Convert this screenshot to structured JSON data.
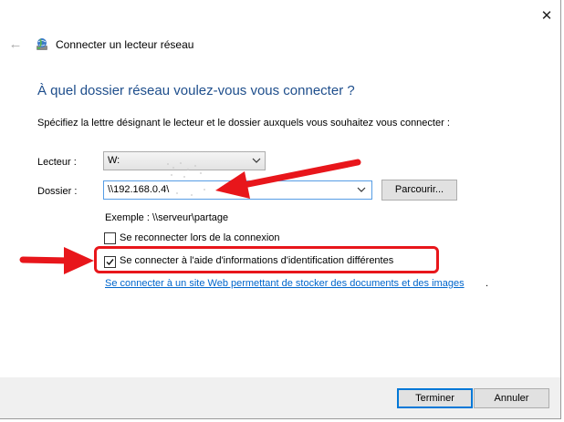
{
  "window": {
    "title": "Connecter un lecteur réseau",
    "close_symbol": "✕",
    "back_symbol": "←"
  },
  "main": {
    "heading": "À quel dossier réseau voulez-vous vous connecter ?",
    "instruction": "Spécifiez la lettre désignant le lecteur et le dossier auxquels vous souhaitez vous connecter :",
    "drive_label": "Lecteur :",
    "drive_value": "W:",
    "folder_label": "Dossier :",
    "folder_value": "\\\\192.168.0.4\\",
    "browse_label": "Parcourir...",
    "example": "Exemple : \\\\serveur\\partage",
    "reconnect_label": "Se reconnecter lors de la connexion",
    "reconnect_checked": false,
    "credentials_label": "Se connecter à l'aide d'informations d'identification différentes",
    "credentials_checked": true,
    "link_text": "Se connecter à un site Web permettant de stocker des documents et des images",
    "link_suffix": "."
  },
  "footer": {
    "finish_label": "Terminer",
    "cancel_label": "Annuler"
  },
  "colors": {
    "heading": "#1e4e8c",
    "link": "#0066cc",
    "annotation_red": "#e8161b",
    "primary_border": "#0078d7"
  },
  "icons": {
    "title_icon": "network-drive-icon",
    "back": "back-arrow-icon",
    "close": "close-icon"
  }
}
